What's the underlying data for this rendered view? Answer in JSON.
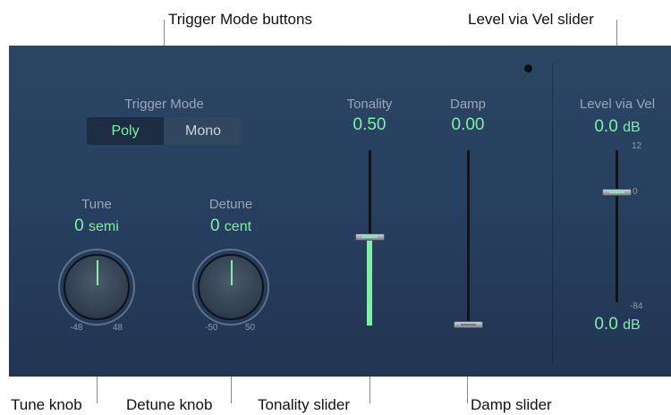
{
  "callouts": {
    "trigger_mode_buttons": "Trigger Mode buttons",
    "level_via_vel_slider": "Level via Vel slider",
    "tune_knob": "Tune knob",
    "detune_knob": "Detune knob",
    "tonality_slider": "Tonality slider",
    "damp_slider": "Damp slider"
  },
  "trigger_mode": {
    "label": "Trigger Mode",
    "options": [
      "Poly",
      "Mono"
    ],
    "selected": "Poly"
  },
  "tune": {
    "label": "Tune",
    "value": "0",
    "unit": "semi",
    "min": "-48",
    "max": "48",
    "position": 0.5
  },
  "detune": {
    "label": "Detune",
    "value": "0",
    "unit": "cent",
    "min": "-50",
    "max": "50",
    "position": 0.5
  },
  "tonality": {
    "label": "Tonality",
    "value": "0.50",
    "level": 0.5
  },
  "damp": {
    "label": "Damp",
    "value": "0.00",
    "level": 0.0
  },
  "level_via_vel": {
    "label": "Level via Vel",
    "value": "0.0",
    "unit": "dB",
    "max_label": "12",
    "zero_label": "0",
    "min_label": "-84",
    "bottom_value": "0.0",
    "bottom_unit": "dB"
  },
  "colors": {
    "accent": "#7ff0a6",
    "panel": "#2a4260",
    "label": "#9aa7b6"
  }
}
